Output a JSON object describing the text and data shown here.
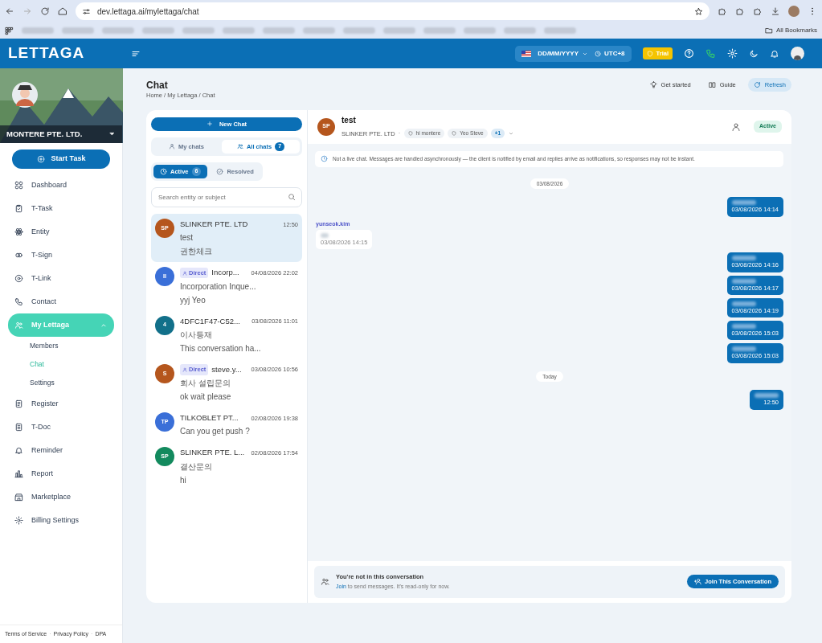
{
  "browser": {
    "url": "dev.lettaga.ai/mylettaga/chat",
    "bookmarks_label": "All Bookmarks"
  },
  "header": {
    "logo": "LETTAGA",
    "date_format": "DD/MM/YYYY",
    "timezone": "UTC+8",
    "plan_badge": "Trial"
  },
  "sidebar": {
    "company": "MONTERE PTE. LTD.",
    "start_task": "Start Task",
    "items": [
      {
        "label": "Dashboard",
        "selected": false
      },
      {
        "label": "T-Task",
        "selected": false
      },
      {
        "label": "Entity",
        "selected": false
      },
      {
        "label": "T-Sign",
        "selected": false
      },
      {
        "label": "T-Link",
        "selected": false
      },
      {
        "label": "Contact",
        "selected": false
      },
      {
        "label": "My Lettaga",
        "selected": true,
        "expanded": true,
        "children": [
          {
            "label": "Members",
            "selected": false
          },
          {
            "label": "Chat",
            "selected": true
          },
          {
            "label": "Settings",
            "selected": false
          }
        ]
      },
      {
        "label": "Register",
        "selected": false
      },
      {
        "label": "T-Doc",
        "selected": false
      },
      {
        "label": "Reminder",
        "selected": false
      },
      {
        "label": "Report",
        "selected": false
      },
      {
        "label": "Marketplace",
        "selected": false
      },
      {
        "label": "Billing Settings",
        "selected": false
      }
    ],
    "footer_links": [
      "Terms of Service",
      "Privacy Policy",
      "DPA"
    ],
    "footer_separator": "·"
  },
  "page": {
    "title": "Chat",
    "breadcrumb": [
      "Home",
      "My Lettaga",
      "Chat"
    ],
    "breadcrumb_separator": "/",
    "actions": [
      "Get started",
      "Guide",
      "Refresh"
    ]
  },
  "chat_list": {
    "new_chat": "New Chat",
    "scope_tabs": [
      {
        "label": "My chats",
        "selected": false
      },
      {
        "label": "All chats",
        "count": "7",
        "selected": true
      }
    ],
    "status_tabs": [
      {
        "label": "Active",
        "count": "6",
        "selected": true
      },
      {
        "label": "Resolved",
        "selected": false
      }
    ],
    "search": {
      "placeholder": "Search entity or subject"
    },
    "conversations": [
      {
        "initials": "SP",
        "color": "#b5561d",
        "name": "SLINKER PTE. LTD",
        "time": "12:50",
        "subject": "test",
        "preview": "권한체크",
        "selected": true
      },
      {
        "initials": "II",
        "color": "#3a6fd8",
        "badge": "Direct",
        "name": "Incorp...",
        "time": "04/08/2026 22:02",
        "subject": "Incorporation Inque...",
        "preview": "yyj Yeo",
        "selected": false
      },
      {
        "initials": "4",
        "color": "#12708a",
        "name": "4DFC1F47-C52...",
        "time": "03/08/2026 11:01",
        "subject": "이사등재",
        "preview": "This conversation ha...",
        "selected": false
      },
      {
        "initials": "S",
        "color": "#b5561d",
        "badge": "Direct",
        "name": "steve.y...",
        "time": "03/08/2026 10:56",
        "subject": "회사 설립문의",
        "preview": "ok wait please",
        "selected": false
      },
      {
        "initials": "TP",
        "color": "#3a6fd8",
        "name": "TILKOBLET PT...",
        "time": "02/08/2026 19:38",
        "subject": "Can you get push ?",
        "selected": false
      },
      {
        "initials": "SP",
        "color": "#138a5e",
        "name": "SLINKER PTE. L...",
        "time": "02/08/2026 17:54",
        "subject": "결산문의",
        "preview": "hi",
        "selected": false
      }
    ]
  },
  "conversation": {
    "initials": "SP",
    "color": "#b5561d",
    "title": "test",
    "company": "SLINKER PTE. LTD",
    "company_separator": "·",
    "members": [
      "hi montere",
      "Yeo Steve"
    ],
    "more": "+1",
    "status": "Active",
    "notice": "Not a live chat. Messages are handled asynchronously — the client is notified by email and replies arrive as notifications, so responses may not be instant.",
    "messages": [
      {
        "kind": "date",
        "text": "03/08/2026"
      },
      {
        "kind": "sent",
        "time": "03/08/2026 14:14"
      },
      {
        "kind": "received",
        "sender": "yunseok.kim",
        "time": "03/08/2026 14:15"
      },
      {
        "kind": "sent",
        "time": "03/08/2026 14:16"
      },
      {
        "kind": "sent",
        "time": "03/08/2026 14:17"
      },
      {
        "kind": "sent",
        "time": "03/08/2026 14:19"
      },
      {
        "kind": "sent",
        "time": "03/08/2026 15:03"
      },
      {
        "kind": "sent",
        "time": "03/08/2026 15:03"
      },
      {
        "kind": "date",
        "text": "Today"
      },
      {
        "kind": "sent",
        "time": "12:50"
      }
    ],
    "join": {
      "title": "You're not in this conversation",
      "link": "Join",
      "hint": "to send messages. It's read-only for now.",
      "button": "Join This Conversation"
    }
  }
}
